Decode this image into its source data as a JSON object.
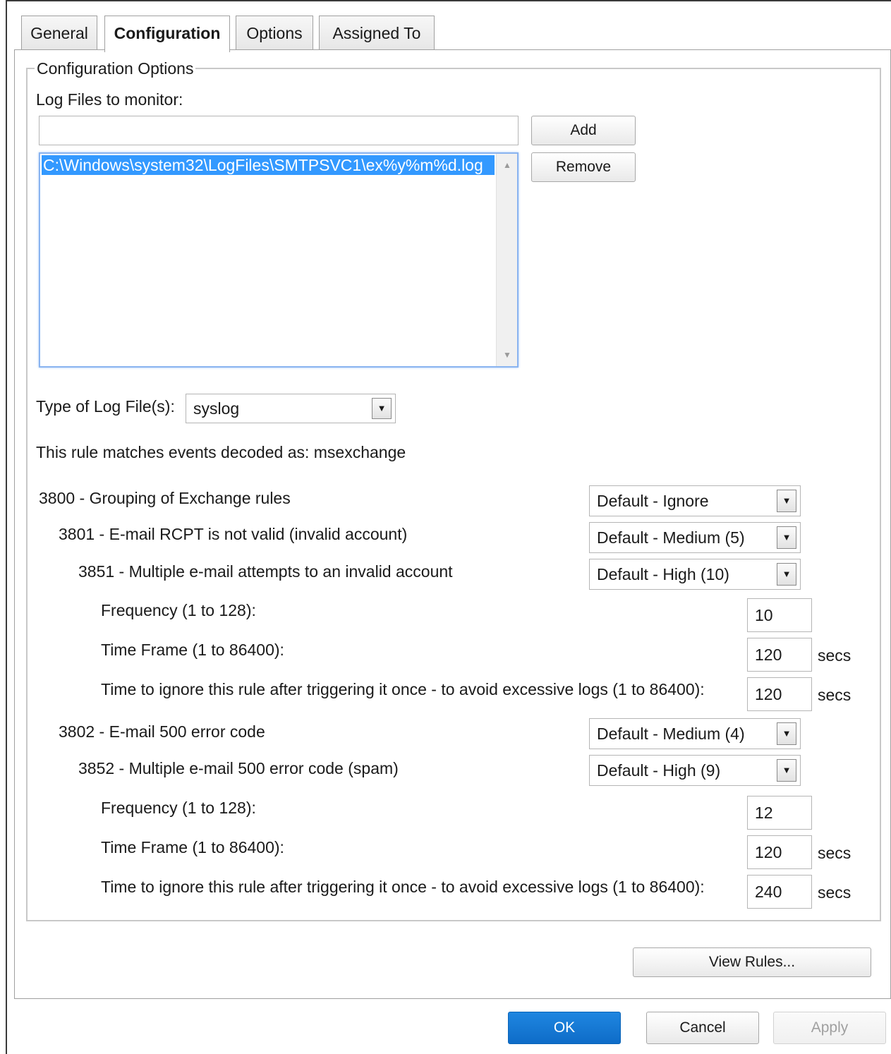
{
  "tabs": [
    {
      "label": "General"
    },
    {
      "label": "Configuration"
    },
    {
      "label": "Options"
    },
    {
      "label": "Assigned To"
    }
  ],
  "config": {
    "group_title": "Configuration Options",
    "log_files_label": "Log Files to monitor:",
    "log_file_input_value": "",
    "add_label": "Add",
    "remove_label": "Remove",
    "log_files": [
      "C:\\Windows\\system32\\LogFiles\\SMTPSVC1\\ex%y%m%d.log"
    ],
    "log_type_label": "Type of Log File(s):",
    "log_type_value": "syslog",
    "matches_text": "This rule matches events decoded as: msexchange"
  },
  "rules": [
    {
      "label": "3800 - Grouping of Exchange rules",
      "level": "Default - Ignore"
    },
    {
      "label": "3801 - E-mail RCPT is not valid (invalid account)",
      "level": "Default - Medium (5)"
    },
    {
      "label": "3851 - Multiple e-mail attempts to an invalid account",
      "level": "Default - High (10)"
    },
    {
      "label": "3802 - E-mail 500 error code",
      "level": "Default - Medium (4)"
    },
    {
      "label": "3852 - Multiple e-mail 500 error code (spam)",
      "level": "Default - High (9)"
    }
  ],
  "params": [
    {
      "label": "Frequency (1 to 128):",
      "value": "10",
      "unit": ""
    },
    {
      "label": "Time Frame (1 to 86400):",
      "value": "120",
      "unit": "secs"
    },
    {
      "label": "Time to ignore this rule after triggering it once - to avoid excessive logs (1 to 86400):",
      "value": "120",
      "unit": "secs"
    },
    {
      "label": "Frequency (1 to 128):",
      "value": "12",
      "unit": ""
    },
    {
      "label": "Time Frame (1 to 86400):",
      "value": "120",
      "unit": "secs"
    },
    {
      "label": "Time to ignore this rule after triggering it once - to avoid excessive logs (1 to 86400):",
      "value": "240",
      "unit": "secs"
    }
  ],
  "view_rules_label": "View Rules...",
  "footer": {
    "ok": "OK",
    "cancel": "Cancel",
    "apply": "Apply"
  },
  "colors": {
    "accent": "#3399ff",
    "ok_button": "#1479d6",
    "disabled_text": "#a0a0a0"
  }
}
